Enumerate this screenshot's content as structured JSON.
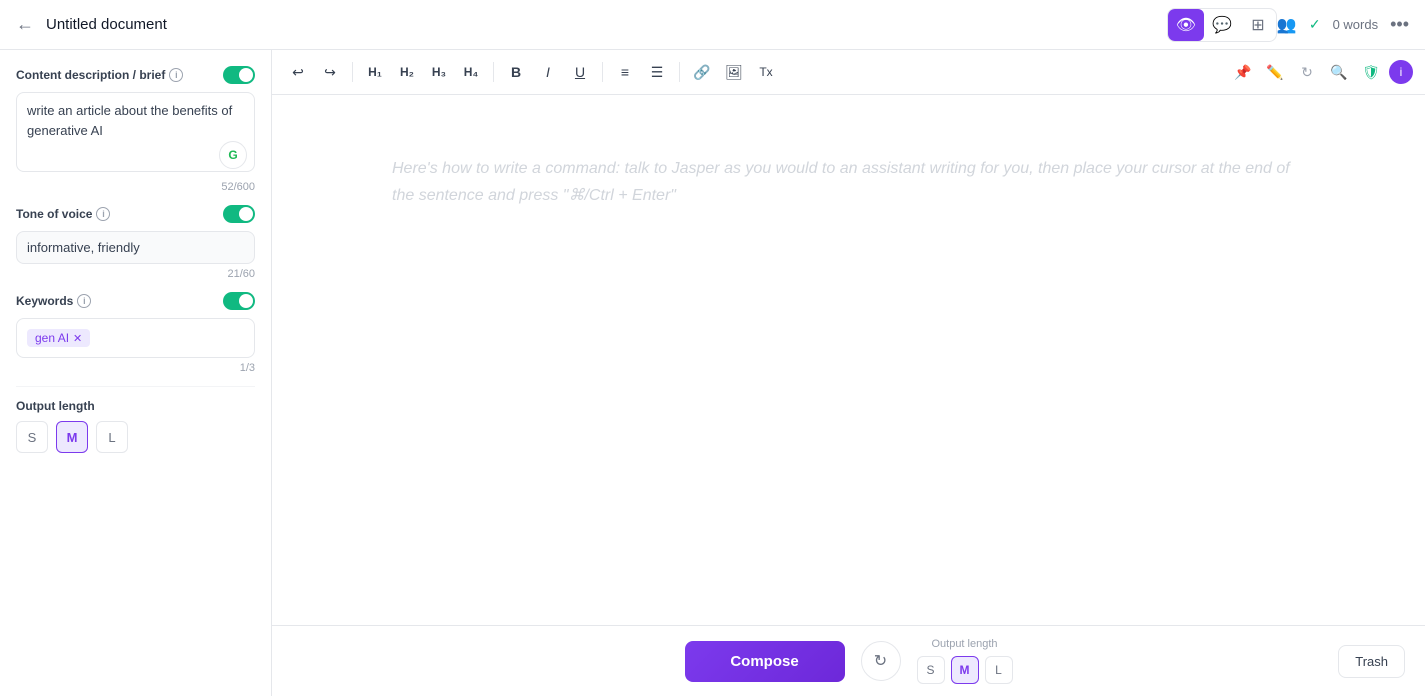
{
  "header": {
    "back_label": "←",
    "title": "Untitled document",
    "tabs": [
      {
        "id": "preview",
        "icon": "👁",
        "active": true
      },
      {
        "id": "chat",
        "icon": "💬",
        "active": false
      },
      {
        "id": "layout",
        "icon": "⬛",
        "active": false
      }
    ],
    "word_count_label": "0 words",
    "more_label": "•••"
  },
  "sidebar": {
    "content_description_label": "Content description / brief",
    "content_description_value": "write an article about the benefits of generative AI",
    "content_description_counter": "52/600",
    "tone_of_voice_label": "Tone of voice",
    "tone_of_voice_value": "informative, friendly",
    "tone_of_voice_counter": "21/60",
    "keywords_label": "Keywords",
    "keywords": [
      {
        "label": "gen AI",
        "id": "gen-ai"
      }
    ],
    "keywords_counter": "1/3",
    "output_length_label": "Output length",
    "output_sizes": [
      "S",
      "M",
      "L"
    ],
    "output_size_active": "M"
  },
  "toolbar": {
    "undo": "↩",
    "redo": "↪",
    "h1": "H1",
    "h2": "H2",
    "h3": "H3",
    "h4": "H4",
    "bold": "B",
    "italic": "I",
    "underline": "U",
    "ordered_list": "≡",
    "unordered_list": "☰",
    "link": "🔗",
    "image": "🖼",
    "clear": "Tx"
  },
  "editor": {
    "placeholder": "Here's how to write a command: talk to Jasper as you would to an assistant writing for you, then place your cursor at the end of the sentence and press \"⌘/Ctrl + Enter\""
  },
  "bottom_bar": {
    "compose_label": "Compose",
    "output_length_label": "Output length",
    "output_sizes": [
      "S",
      "M",
      "L"
    ],
    "output_size_active": "M",
    "trash_label": "Trash"
  }
}
